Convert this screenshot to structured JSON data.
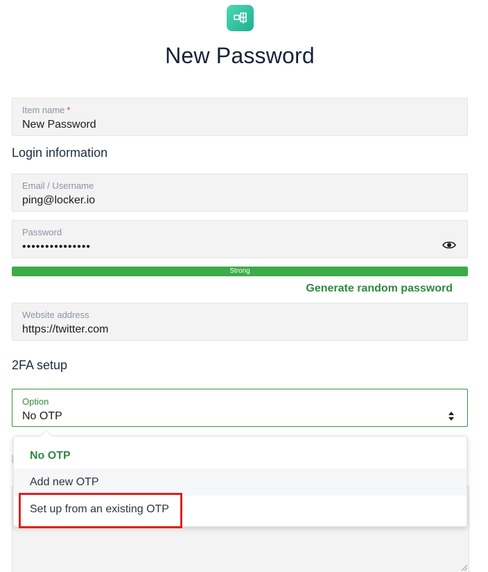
{
  "header": {
    "title": "New Password",
    "logo_icon": "locker-logo-icon"
  },
  "item_name": {
    "label": "Item name",
    "required_mark": "*",
    "value": "New Password"
  },
  "login_section": {
    "title": "Login information"
  },
  "email": {
    "label": "Email / Username",
    "value": "ping@locker.io"
  },
  "password": {
    "label": "Password",
    "value": "•••••••••••••••",
    "toggle_icon": "eye-icon"
  },
  "strength": {
    "label": "Strong",
    "color": "#3cab49",
    "level": 1.0
  },
  "generate_link": "Generate random password",
  "website": {
    "label": "Website address",
    "value": "https://twitter.com"
  },
  "twofa_section": {
    "title": "2FA setup"
  },
  "otp_select": {
    "label": "Option",
    "value": "No OTP",
    "options": [
      "No OTP",
      "Add new OTP",
      "Set up from an existing OTP"
    ],
    "selected_index": 0,
    "hovered_index": 1,
    "highlighted_index": 2
  },
  "colors": {
    "accent": "#2f8a3e",
    "title": "#162236",
    "highlight": "#e0201f"
  }
}
